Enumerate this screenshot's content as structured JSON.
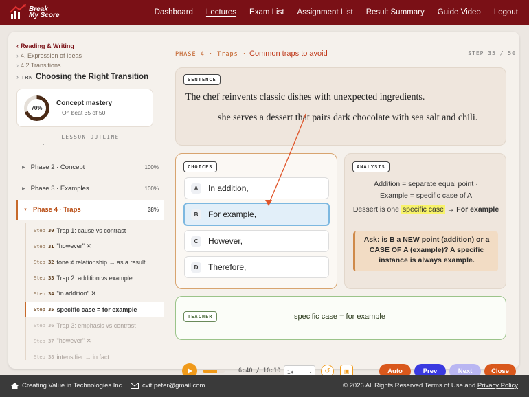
{
  "brand": {
    "line1": "Break",
    "line2": "My Score"
  },
  "nav": [
    "Dashboard",
    "Lectures",
    "Exam List",
    "Assignment List",
    "Result Summary",
    "Guide Video",
    "Logout"
  ],
  "breadcrumb": {
    "top": "Reading & Writing",
    "level2": "4. Expression of Ideas",
    "level3": "4.2 Transitions"
  },
  "lesson": {
    "code": "TRN",
    "title": "Choosing the Right Transition"
  },
  "mastery": {
    "percent": "70%",
    "percent_value": 0.7,
    "title": "Concept mastery",
    "sub": "On beat 35 of 50"
  },
  "outline_label": "LESSON OUTLINE",
  "phases": [
    {
      "label": "Phase 2 · Concept",
      "pct": "100%"
    },
    {
      "label": "Phase 3 · Examples",
      "pct": "100%"
    },
    {
      "label": "Phase 4 · Traps",
      "pct": "38%"
    }
  ],
  "steps": [
    {
      "num": "30",
      "text": "Trap 1: cause vs contrast"
    },
    {
      "num": "31",
      "text": "\"however\" ✕"
    },
    {
      "num": "32",
      "text": "tone ≠ relationship → as a result"
    },
    {
      "num": "33",
      "text": "Trap 2: addition vs example"
    },
    {
      "num": "34",
      "text": "\"in addition\" ✕"
    },
    {
      "num": "35",
      "text": "specific case = for example"
    },
    {
      "num": "36",
      "text": "Trap 3: emphasis vs contrast"
    },
    {
      "num": "37",
      "text": "\"however\" ✕"
    },
    {
      "num": "38",
      "text": "intensifier → in fact"
    }
  ],
  "step_prefix": "Step",
  "header": {
    "phase": "PHASE 4 · Traps ·",
    "title": "Common traps to avoid",
    "step": "STEP 35 / 50"
  },
  "sentence": {
    "tag": "SENTENCE",
    "line1": "The chef reinvents classic dishes with unexpected ingredients.",
    "line2": "she serves a dessert that pairs dark chocolate with sea salt and chili."
  },
  "choices": {
    "tag": "CHOICES",
    "items": [
      {
        "letter": "A",
        "text": "In addition,"
      },
      {
        "letter": "B",
        "text": "For example,"
      },
      {
        "letter": "C",
        "text": "However,"
      },
      {
        "letter": "D",
        "text": "Therefore,"
      }
    ],
    "selected": "B"
  },
  "analysis": {
    "tag": "ANALYSIS",
    "line1": "Addition = separate equal point ·",
    "line2": "Example = specific case of A",
    "line3_pre": "Dessert is one",
    "line3_hl": "specific case",
    "line3_post": "→ For example",
    "ask": "Ask: is B a NEW point (addition) or a CASE OF A (example)? A specific instance is always example."
  },
  "teacher": {
    "tag": "TEACHER",
    "text": "specific case = for example"
  },
  "player": {
    "time": "6:40 / 10:10",
    "speed": "1x",
    "progress": 0.66
  },
  "buttons": {
    "auto": "Auto",
    "prev": "Prev",
    "next": "Next",
    "close": "Close"
  },
  "colors": {
    "auto": "#d9581c",
    "prev": "#3a3ae0",
    "next": "#b9b6f2",
    "close": "#d9581c",
    "brand": "#7a1016"
  },
  "footer": {
    "company": "Creating Value in Technologies Inc.",
    "email": "cvit.peter@gmail.com",
    "copyright": "© 2026 All Rights Reserved Terms of Use and",
    "privacy": "Privacy Policy"
  }
}
